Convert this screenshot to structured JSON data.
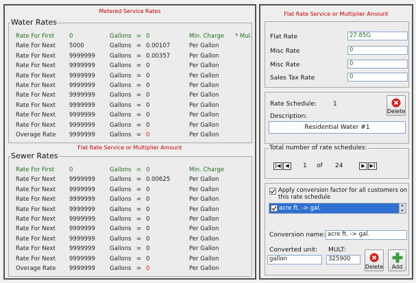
{
  "left": {
    "top_title": "Metered Service Rates",
    "water": {
      "legend": "Water Rates",
      "rows": [
        {
          "label": "Rate For First",
          "qty": "0",
          "gal": "Gallons",
          "eq": "=",
          "val": "0",
          "charge": "Min. Charge",
          "extra": "* Mul."
        },
        {
          "label": "Rate For Next",
          "qty": "5000",
          "gal": "Gallons",
          "eq": "=",
          "val": "0.00107",
          "charge": "Per Gallon",
          "extra": ""
        },
        {
          "label": "Rate For Next",
          "qty": "9999999",
          "gal": "Gallons",
          "eq": "=",
          "val": "0.00357",
          "charge": "Per Gallon",
          "extra": ""
        },
        {
          "label": "Rate For Next",
          "qty": "9999999",
          "gal": "Gallons",
          "eq": "=",
          "val": "0",
          "charge": "Per Gallon",
          "extra": ""
        },
        {
          "label": "Rate For Next",
          "qty": "9999999",
          "gal": "Gallons",
          "eq": "=",
          "val": "0",
          "charge": "Per Gallon",
          "extra": ""
        },
        {
          "label": "Rate For Next",
          "qty": "9999999",
          "gal": "Gallons",
          "eq": "=",
          "val": "0",
          "charge": "Per Gallon",
          "extra": ""
        },
        {
          "label": "Rate For Next",
          "qty": "9999999",
          "gal": "Gallons",
          "eq": "=",
          "val": "0",
          "charge": "Per Gallon",
          "extra": ""
        },
        {
          "label": "Rate For Next",
          "qty": "9999999",
          "gal": "Gallons",
          "eq": "=",
          "val": "0",
          "charge": "Per Gallon",
          "extra": ""
        },
        {
          "label": "Rate For Next",
          "qty": "9999999",
          "gal": "Gallons",
          "eq": "=",
          "val": "0",
          "charge": "Per Gallon",
          "extra": ""
        },
        {
          "label": "Rate For Next",
          "qty": "9999999",
          "gal": "Gallons",
          "eq": "=",
          "val": "0",
          "charge": "Per Gallon",
          "extra": ""
        },
        {
          "label": "Overage Rate",
          "qty": "9999999",
          "gal": "Gallons",
          "eq": "=",
          "val": "0",
          "charge": "Per Gallon",
          "extra": ""
        }
      ]
    },
    "sewer_title": "Flat Rate Service or Multiplier Amount",
    "sewer": {
      "legend": "Sewer Rates",
      "rows": [
        {
          "label": "Rate For First",
          "qty": "0",
          "gal": "Gallons",
          "eq": "=",
          "val": "0",
          "charge": "Min. Charge"
        },
        {
          "label": "Rate For Next",
          "qty": "9999999",
          "gal": "Gallons",
          "eq": "=",
          "val": "0.00625",
          "charge": "Per Gallon"
        },
        {
          "label": "Rate For Next",
          "qty": "9999999",
          "gal": "Gallons",
          "eq": "=",
          "val": "0",
          "charge": "Per Gallon"
        },
        {
          "label": "Rate For Next",
          "qty": "9999999",
          "gal": "Gallons",
          "eq": "=",
          "val": "0",
          "charge": "Per Gallon"
        },
        {
          "label": "Rate For Next",
          "qty": "9999999",
          "gal": "Gallons",
          "eq": "=",
          "val": "0",
          "charge": "Per Gallon"
        },
        {
          "label": "Rate For Next",
          "qty": "9999999",
          "gal": "Gallons",
          "eq": "=",
          "val": "0",
          "charge": "Per Gallon"
        },
        {
          "label": "Rate For Next",
          "qty": "9999999",
          "gal": "Gallons",
          "eq": "=",
          "val": "0",
          "charge": "Per Gallon"
        },
        {
          "label": "Rate For Next",
          "qty": "9999999",
          "gal": "Gallons",
          "eq": "=",
          "val": "0",
          "charge": "Per Gallon"
        },
        {
          "label": "Rate For Next",
          "qty": "9999999",
          "gal": "Gallons",
          "eq": "=",
          "val": "0",
          "charge": "Per Gallon"
        },
        {
          "label": "Rate For Next",
          "qty": "9999999",
          "gal": "Gallons",
          "eq": "=",
          "val": "0",
          "charge": "Per Gallon"
        },
        {
          "label": "Overage Rate",
          "qty": "9999999",
          "gal": "Gallons",
          "eq": "=",
          "val": "0",
          "charge": "Per Gallon"
        }
      ]
    }
  },
  "right": {
    "flat_title": "Flat Rate Service or Multiplier Amount",
    "flat_rate_label": "Flat Rate",
    "flat_rate_value": "27.85G",
    "misc_rate1_label": "Misc Rate",
    "misc_rate1_value": "0",
    "misc_rate2_label": "Misc Rate",
    "misc_rate2_value": "0",
    "sales_tax_label": "Sales Tax Rate",
    "sales_tax_value": "0",
    "schedule_label": "Rate Schedule:",
    "schedule_value": "1",
    "delete_label": "Delete",
    "description_label": "Description:",
    "description_value": "Residential Water #1",
    "total_legend": "Total number of rate schedules:",
    "nav_first": "|◀",
    "nav_prev": "◀",
    "nav_current": "1",
    "nav_of": "of",
    "nav_total": "24",
    "nav_next": "▶",
    "nav_last": "▶|",
    "apply_label": "Apply conversion factor for all customers on this rate schedule",
    "conversion_item": "acre ft. -> gal.",
    "conversion_name_label": "Conversion name:",
    "conversion_name_value": "acre ft. -> gal.",
    "converted_unit_label": "Converted unit:",
    "converted_unit_value": "gallon",
    "mult_label": "MULT:",
    "mult_value": "325900",
    "delete2_label": "Delete",
    "add_label": "Add"
  },
  "colors": {
    "red": "#c00000",
    "green": "#207020",
    "accent": "#3070d0"
  }
}
